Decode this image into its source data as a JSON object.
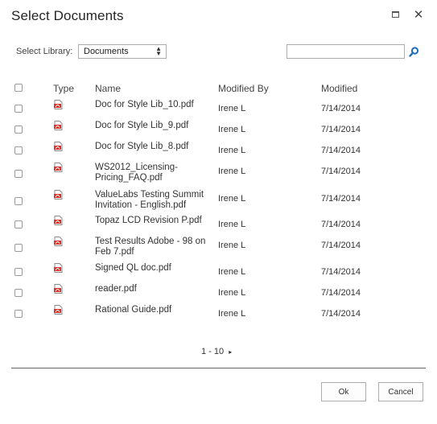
{
  "dialog": {
    "title": "Select Documents"
  },
  "toolbar": {
    "library_label": "Select Library:",
    "library_value": "Documents",
    "search_placeholder": ""
  },
  "table": {
    "headers": {
      "type": "Type",
      "name": "Name",
      "modified_by": "Modified By",
      "modified": "Modified"
    },
    "rows": [
      {
        "name": "Doc for Style Lib_10.pdf",
        "modified_by": "Irene L",
        "modified": "7/14/2014",
        "icon": "pdf-icon"
      },
      {
        "name": "Doc for Style Lib_9.pdf",
        "modified_by": "Irene L",
        "modified": "7/14/2014",
        "icon": "pdf-icon"
      },
      {
        "name": "Doc for Style Lib_8.pdf",
        "modified_by": "Irene L",
        "modified": "7/14/2014",
        "icon": "pdf-icon"
      },
      {
        "name": "WS2012_Licensing-Pricing_FAQ.pdf",
        "modified_by": "Irene L",
        "modified": "7/14/2014",
        "icon": "pdf-icon"
      },
      {
        "name": "ValueLabs Testing Summit Invitation - English.pdf",
        "modified_by": "Irene L",
        "modified": "7/14/2014",
        "icon": "pdf-icon"
      },
      {
        "name": "Topaz LCD Revision P.pdf",
        "modified_by": "Irene L",
        "modified": "7/14/2014",
        "icon": "pdf-icon"
      },
      {
        "name": "Test Results Adobe - 98 on Feb 7.pdf",
        "modified_by": "Irene L",
        "modified": "7/14/2014",
        "icon": "pdf-icon"
      },
      {
        "name": "Signed QL doc.pdf",
        "modified_by": "Irene L",
        "modified": "7/14/2014",
        "icon": "pdf-icon"
      },
      {
        "name": "reader.pdf",
        "modified_by": "Irene L",
        "modified": "7/14/2014",
        "icon": "pdf-icon"
      },
      {
        "name": "Rational Guide.pdf",
        "modified_by": "Irene L",
        "modified": "7/14/2014",
        "icon": "pdf-icon"
      }
    ]
  },
  "pager": {
    "range": "1 - 10",
    "next_glyph": "▸"
  },
  "buttons": {
    "ok": "Ok",
    "cancel": "Cancel"
  },
  "colors": {
    "pdf_red": "#d9322b",
    "search_blue": "#1c6fb8"
  }
}
